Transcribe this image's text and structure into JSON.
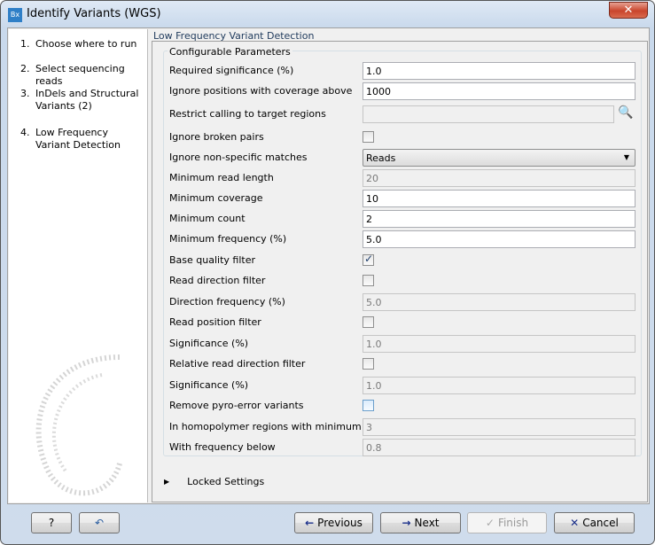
{
  "window": {
    "title": "Identify Variants (WGS)",
    "icon": "Bx",
    "close_icon": "close-icon"
  },
  "steps": [
    {
      "num": "1.",
      "label": "Choose where to run"
    },
    {
      "num": "2.",
      "label": "Select sequencing reads"
    },
    {
      "num": "3.",
      "label": "InDels and Structural Variants (2)"
    },
    {
      "num": "4.",
      "label": "Low Frequency Variant Detection"
    }
  ],
  "panel": {
    "header": "Low Frequency Variant Detection",
    "group_title": "Configurable Parameters",
    "locked_label": "Locked Settings"
  },
  "params": [
    {
      "label": "Required significance (%)",
      "type": "text",
      "value": "1.0"
    },
    {
      "label": "Ignore positions with coverage above",
      "type": "text",
      "value": "1000"
    },
    {
      "label": "Restrict calling to target regions",
      "type": "browse",
      "value": ""
    },
    {
      "label": "Ignore broken pairs",
      "type": "checkbox",
      "checked": false
    },
    {
      "label": "Ignore non-specific matches",
      "type": "select",
      "value": "Reads"
    },
    {
      "label": "Minimum read length",
      "type": "disabled",
      "value": "20"
    },
    {
      "label": "Minimum coverage",
      "type": "text",
      "value": "10"
    },
    {
      "label": "Minimum count",
      "type": "text",
      "value": "2"
    },
    {
      "label": "Minimum frequency (%)",
      "type": "text",
      "value": "5.0"
    },
    {
      "label": "Base quality filter",
      "type": "checkbox",
      "checked": true
    },
    {
      "label": "Read direction filter",
      "type": "checkbox",
      "checked": false
    },
    {
      "label": "Direction frequency (%)",
      "type": "disabled",
      "value": "5.0"
    },
    {
      "label": "Read position filter",
      "type": "checkbox",
      "checked": false
    },
    {
      "label": "Significance (%)",
      "type": "disabled",
      "value": "1.0"
    },
    {
      "label": "Relative read direction filter",
      "type": "checkbox",
      "checked": false
    },
    {
      "label": "Significance (%)",
      "type": "disabled",
      "value": "1.0"
    },
    {
      "label": "Remove pyro-error variants",
      "type": "checkbox",
      "checked": false,
      "focused": true
    },
    {
      "label": "In homopolymer regions with minimum length",
      "type": "disabled",
      "value": "3"
    },
    {
      "label": "With frequency below",
      "type": "disabled",
      "value": "0.8"
    }
  ],
  "buttons": {
    "help": "?",
    "reset": "↶",
    "previous": "Previous",
    "next": "Next",
    "finish": "Finish",
    "cancel": "Cancel"
  }
}
